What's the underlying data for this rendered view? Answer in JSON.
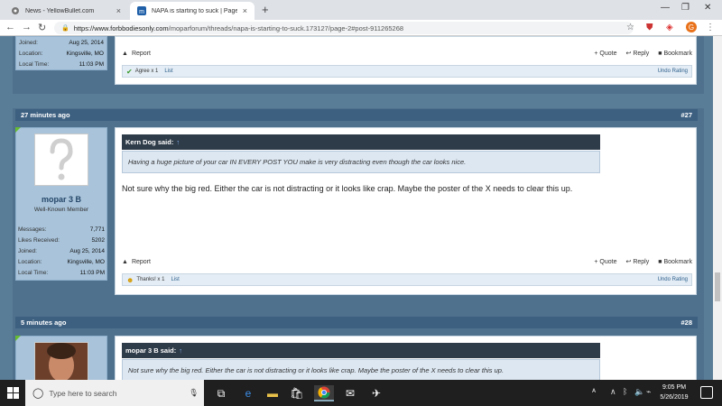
{
  "browser": {
    "tabs": [
      {
        "title": "News - YellowBullet.com",
        "active": false
      },
      {
        "title": "NAPA is starting to suck | Page 2",
        "active": true
      }
    ],
    "url_domain": "https://www.forbbodiesonly.com",
    "url_path": "/moparforum/threads/napa-is-starting-to-suck.173127/page-2#post-911265268"
  },
  "post_top": {
    "user_rows": [
      {
        "label": "Joined:",
        "value": "Aug 25, 2014"
      },
      {
        "label": "Location:",
        "value": "Kingsville, MO"
      },
      {
        "label": "Local Time:",
        "value": "11:03 PM"
      }
    ],
    "report": "Report",
    "quote": "+ Quote",
    "reply": "Reply",
    "bookmark": "Bookmark",
    "rating_text": "Agree x 1",
    "rating_list": "List",
    "undo": "Undo Rating"
  },
  "post27": {
    "time": "27 minutes ago",
    "number": "#27",
    "username": "mopar 3 B",
    "usertitle": "Well-Known Member",
    "user_rows": [
      {
        "label": "Messages:",
        "value": "7,771"
      },
      {
        "label": "Likes Received:",
        "value": "5202"
      },
      {
        "label": "Joined:",
        "value": "Aug 25, 2014"
      },
      {
        "label": "Location:",
        "value": "Kingsville, MO"
      },
      {
        "label": "Local Time:",
        "value": "11:03 PM"
      }
    ],
    "quote_author": "Kern Dog said:",
    "quote_text": "Having a huge picture of your car IN EVERY POST YOU make is very distracting even though the car looks nice.",
    "message": "Not sure why the big red. Either the car is not distracting or it looks like crap. Maybe the poster of the X needs to clear this up.",
    "report": "Report",
    "quote": "+ Quote",
    "reply": "Reply",
    "bookmark": "Bookmark",
    "rating_text": "Thanks! x 1",
    "rating_list": "List",
    "undo": "Undo Rating"
  },
  "post28": {
    "time": "5 minutes ago",
    "number": "#28",
    "quote_author": "mopar 3 B said:",
    "quote_text": "Not sure why the big red. Either the car is not distracting or it looks like crap. Maybe the poster of the X needs to clear this up."
  },
  "taskbar": {
    "search_placeholder": "Type here to search",
    "time": "9:05 PM",
    "date": "5/26/2019"
  }
}
